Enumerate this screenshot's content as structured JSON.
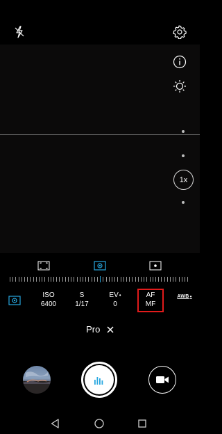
{
  "top_bar": {
    "flash_icon": "flash-off-icon",
    "settings_icon": "gear-icon"
  },
  "side_controls": {
    "info_icon": "info-icon",
    "brightness_icon": "sun-icon",
    "zoom_label": "1x"
  },
  "metering": {
    "options": [
      "matrix-metering-icon",
      "center-weighted-metering-icon",
      "spot-metering-icon"
    ],
    "selected": "center-weighted-metering-icon",
    "accent_color": "#27a7e0"
  },
  "pro_params": {
    "iso": {
      "label": "ISO",
      "value": "6400"
    },
    "shutter": {
      "label": "S",
      "value": "1/17"
    },
    "ev": {
      "label": "EV",
      "value": "0"
    },
    "af": {
      "label": "AF",
      "value": "MF"
    },
    "awb": {
      "label": "AWB"
    }
  },
  "mode": {
    "label": "Pro",
    "close_icon": "close-icon"
  },
  "bottom_controls": {
    "gallery_icon": "gallery-thumbnail",
    "shutter_icon": "shutter-icon",
    "video_icon": "video-camera-icon"
  },
  "navbar": {
    "back_icon": "back-triangle-icon",
    "home_icon": "home-circle-icon",
    "recents_icon": "recents-square-icon"
  },
  "highlight_color": "#e21b1b"
}
